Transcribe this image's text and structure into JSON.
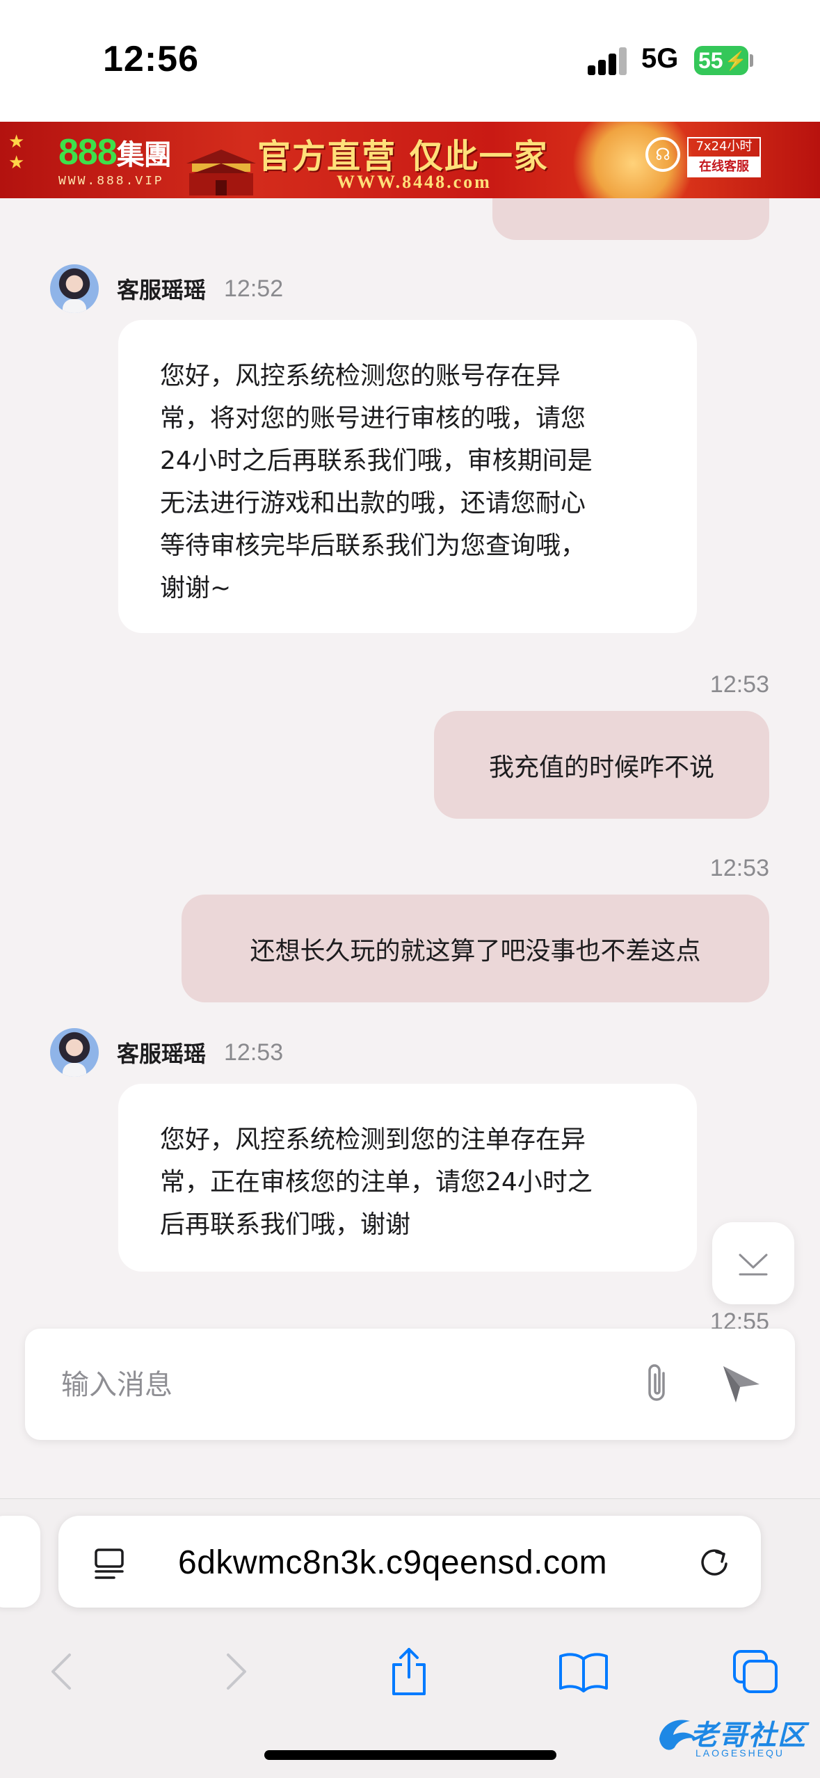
{
  "status_bar": {
    "time": "12:56",
    "network": "5G",
    "battery": "55"
  },
  "banner": {
    "brand_number": "888",
    "brand_name": "集團",
    "brand_url": "WWW.888.VIP",
    "slogan": "官方直营 仅此一家",
    "domain": "WWW.8448.com",
    "service_hours": "7x24小时",
    "service_label": "在线客服"
  },
  "chat": {
    "messages": [
      {
        "sender": "客服瑶瑶",
        "time": "12:52",
        "lines": [
          "您好，风控系统检测您的账号存在异",
          "常，将对您的账号进行审核的哦，请您",
          "24小时之后再联系我们哦，审核期间是",
          "无法进行游戏和出款的哦，还请您耐心",
          "等待审核完毕后联系我们为您查询哦，",
          "谢谢~"
        ]
      },
      {
        "time": "12:53",
        "text": "我充值的时候咋不说"
      },
      {
        "time": "12:53",
        "text": "还想长久玩的就这算了吧没事也不差这点"
      },
      {
        "sender": "客服瑶瑶",
        "time": "12:53",
        "lines": [
          "您好，风控系统检测到您的注单存在异",
          "常，正在审核您的注单，请您24小时之",
          "后再联系我们哦，谢谢"
        ]
      }
    ],
    "last_timestamp": "12:55"
  },
  "input": {
    "placeholder": "输入消息"
  },
  "browser": {
    "url": "6dkwmc8n3k.c9qeensd.com"
  },
  "watermark": {
    "name": "老哥社区",
    "sub": "LAOGESHEQU"
  },
  "colors": {
    "outgoing_bubble": "#ebd7d8",
    "incoming_bubble": "#ffffff",
    "chat_background": "#f5f2f3",
    "browser_accent": "#007aff"
  }
}
